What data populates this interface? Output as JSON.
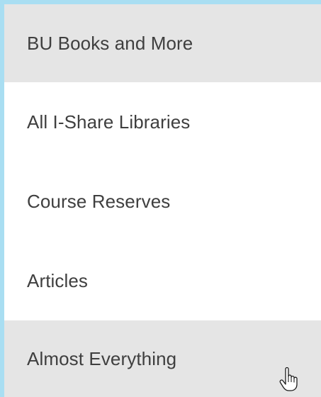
{
  "menu": {
    "items": [
      {
        "label": "BU Books and More",
        "shaded": true
      },
      {
        "label": "All I-Share Libraries",
        "shaded": false
      },
      {
        "label": "Course Reserves",
        "shaded": false
      },
      {
        "label": "Articles",
        "shaded": false
      },
      {
        "label": "Almost Everything",
        "shaded": true
      }
    ]
  },
  "colors": {
    "frame_border": "#a9def2",
    "item_background": "#ffffff",
    "item_shaded_background": "#e5e5e5",
    "item_text": "#3f3f3f"
  },
  "icons": {
    "pointer": "hand-pointer-icon"
  }
}
